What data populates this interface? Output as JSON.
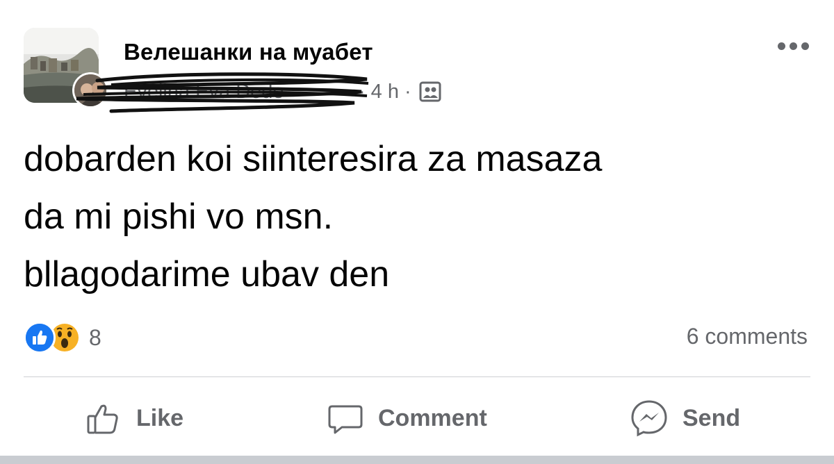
{
  "post": {
    "group_name": "Велешанки на муабет",
    "author_name": "Evelina Eva Dede",
    "separator": "·",
    "time": "4 h",
    "audience": "group-icon",
    "text_lines": [
      "dobarden koi siinteresira za masaza",
      "da mi pishi vo msn.",
      "bllagodarime ubav den"
    ]
  },
  "reactions": {
    "icons": [
      "like-icon",
      "wow-icon"
    ],
    "count": "8"
  },
  "comments": {
    "label": "6 comments"
  },
  "actions": {
    "like": "Like",
    "comment": "Comment",
    "send": "Send"
  },
  "colors": {
    "accent": "#1877f2",
    "secondary_text": "#65676b",
    "divider": "#ced0d4"
  }
}
